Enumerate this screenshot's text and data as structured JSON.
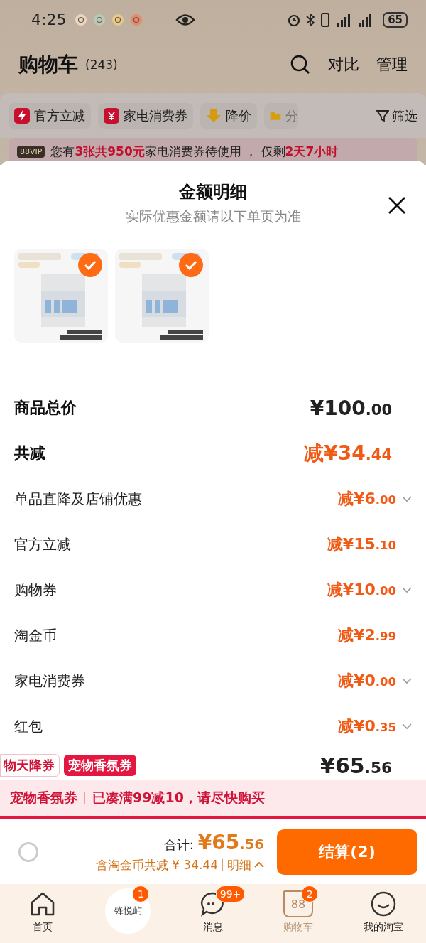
{
  "status_bar": {
    "time": "4:25",
    "battery": "65"
  },
  "header": {
    "title": "购物车",
    "count": "(243)",
    "actions": [
      "对比",
      "管理"
    ]
  },
  "filters": [
    {
      "label": "官方立减",
      "kind": "bolt"
    },
    {
      "label": "家电消费券",
      "kind": "ticket"
    },
    {
      "label": "降价",
      "kind": "drop"
    },
    {
      "label": "分",
      "kind": "folder"
    }
  ],
  "filter_button": "筛选",
  "vip_banner": {
    "badge": "88VIP",
    "parts": [
      {
        "text": "您有",
        "highlight": false
      },
      {
        "text": "3张共950元",
        "highlight": true
      },
      {
        "text": "家电消费券待使用 ， 仅剩",
        "highlight": false
      },
      {
        "text": "2天7小时",
        "highlight": true
      }
    ]
  },
  "sheet": {
    "title": "金额明细",
    "subtitle": "实际优惠金额请以下单页为准",
    "products": [
      {
        "kind": "picture",
        "checked": true
      },
      {
        "kind": "picture",
        "checked": true
      }
    ],
    "rows": [
      {
        "kind": "main",
        "label": "商品总价",
        "amount": "¥100",
        "cents": ".00",
        "discount": false,
        "expandable": false
      },
      {
        "kind": "main",
        "label": "共减",
        "amount": "减¥34",
        "cents": ".44",
        "discount": true,
        "expandable": false
      },
      {
        "kind": "detail",
        "label": "单品直降及店铺优惠",
        "amount": "减¥6",
        "cents": ".00",
        "discount": true,
        "expandable": true
      },
      {
        "kind": "detail",
        "label": "官方立减",
        "amount": "减¥15",
        "cents": ".10",
        "discount": true,
        "expandable": false
      },
      {
        "kind": "detail",
        "label": "购物券",
        "amount": "减¥10",
        "cents": ".00",
        "discount": true,
        "expandable": true
      },
      {
        "kind": "detail",
        "label": "淘金币",
        "amount": "减¥2",
        "cents": ".99",
        "discount": true,
        "expandable": false
      },
      {
        "kind": "detail",
        "label": "家电消费券",
        "amount": "减¥0",
        "cents": ".00",
        "discount": true,
        "expandable": true
      },
      {
        "kind": "detail",
        "label": "红包",
        "amount": "减¥0",
        "cents": ".35",
        "discount": true,
        "expandable": true
      }
    ],
    "tags": [
      {
        "label": "物天降券",
        "filled": false
      },
      {
        "label": "宠物香氛券",
        "filled": true
      }
    ],
    "total": {
      "amount": "¥65",
      "cents": ".56"
    }
  },
  "coupon_banner": {
    "name": "宠物香氛券",
    "message": "已凑满99减10，请尽快购买"
  },
  "checkout": {
    "select_all_checked": false,
    "total_label": "合计:",
    "total_amount": "¥65",
    "total_cents": ".56",
    "savings": "含淘金币共减 ¥ 34.44",
    "detail_link": "明细",
    "button": "结算(2)"
  },
  "tab_bar": [
    {
      "kind": "home",
      "label": "首页",
      "selected": false
    },
    {
      "kind": "avatar",
      "logo": "锋悦屿",
      "badge": "1",
      "selected": false
    },
    {
      "kind": "message",
      "label": "消息",
      "badge": "99+",
      "selected": false
    },
    {
      "kind": "cart",
      "label": "购物车",
      "cart_mark": "88",
      "badge": "2",
      "selected": true
    },
    {
      "kind": "profile",
      "label": "我的淘宝",
      "selected": false
    }
  ]
}
